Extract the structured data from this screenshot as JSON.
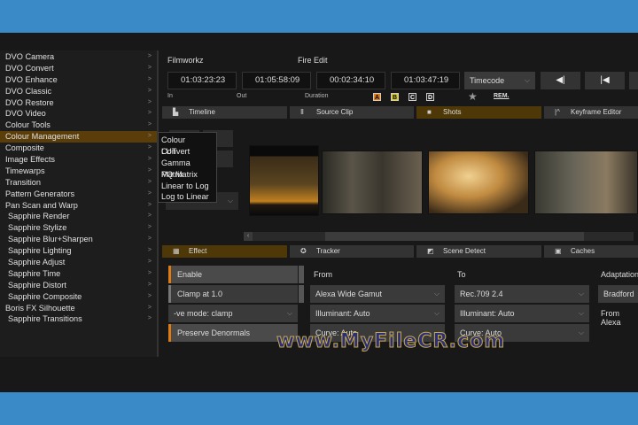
{
  "menu": {
    "items": [
      {
        "label": "DVO Camera"
      },
      {
        "label": "DVO Convert"
      },
      {
        "label": "DVO Enhance"
      },
      {
        "label": "DVO Classic"
      },
      {
        "label": "DVO Restore"
      },
      {
        "label": "DVO Video"
      },
      {
        "label": "Colour Tools"
      },
      {
        "label": "Colour Management",
        "highlighted": true
      },
      {
        "label": "Composite"
      },
      {
        "label": "Image Effects"
      },
      {
        "label": "Timewarps"
      },
      {
        "label": "Transition"
      },
      {
        "label": "Pattern Generators"
      },
      {
        "label": "Pan Scan and Warp"
      },
      {
        "label": "Sapphire Render"
      },
      {
        "label": "Sapphire Stylize"
      },
      {
        "label": "Sapphire Blur+Sharpen"
      },
      {
        "label": "Sapphire Lighting"
      },
      {
        "label": "Sapphire Adjust"
      },
      {
        "label": "Sapphire Time"
      },
      {
        "label": "Sapphire Distort"
      },
      {
        "label": "Sapphire Composite"
      },
      {
        "label": "Boris FX Silhouette"
      },
      {
        "label": "Sapphire Transitions"
      }
    ],
    "arrow": ">",
    "submenu": [
      "Colour Convert",
      "LUT",
      "Gamma Matrix",
      "PQ Matrix",
      "Linear to Log",
      "Log to Linear"
    ]
  },
  "header": {
    "project": "Filmworkz",
    "clip": "Fire Edit"
  },
  "timecodes": {
    "in": "01:03:23:23",
    "out": "01:05:58:09",
    "duration": "00:02:34:10",
    "current": "01:03:47:19",
    "in_label": "In",
    "out_label": "Out",
    "duration_label": "Duration",
    "mode": "Timecode"
  },
  "badges": [
    "A",
    "B",
    "C",
    "D"
  ],
  "badge_colors": {
    "A": "#e07a12",
    "B": "#e0d010",
    "C": "#222",
    "D": "#222"
  },
  "rem_label": "REM.",
  "top_tabs": [
    {
      "label": "Timeline",
      "icon": "timeline-icon"
    },
    {
      "label": "Source Clip",
      "icon": "source-clip-icon"
    },
    {
      "label": "Shots",
      "icon": "shots-icon",
      "active": true
    },
    {
      "label": "Keyframe Editor",
      "icon": "keyframe-icon"
    }
  ],
  "bottom_tabs": [
    {
      "label": "Effect",
      "icon": "grid-icon",
      "active": true
    },
    {
      "label": "Tracker",
      "icon": "tracker-icon"
    },
    {
      "label": "Scene Detect",
      "icon": "scene-detect-icon"
    },
    {
      "label": "Caches",
      "icon": "caches-icon"
    }
  ],
  "effect": {
    "toggles": [
      {
        "label": "Enable",
        "on": true
      },
      {
        "label": "Clamp at 1.0",
        "on": false
      }
    ],
    "ve_mode": "-ve mode: clamp",
    "preserve": "Preserve Denormals",
    "from_label": "From",
    "to_label": "To",
    "adaptation_label": "Adaptation",
    "from": {
      "gamut": "Alexa Wide Gamut",
      "illuminant": "Illuminant: Auto",
      "curve": "Curve: Auto"
    },
    "to": {
      "gamut": "Rec.709 2.4",
      "illuminant": "Illuminant: Auto",
      "curve": "Curve: Auto"
    },
    "adaptation": "Bradford",
    "adaptation_note": "From Alexa"
  },
  "watermark": "www.MyFileCR.com",
  "accent": "#e07a12"
}
